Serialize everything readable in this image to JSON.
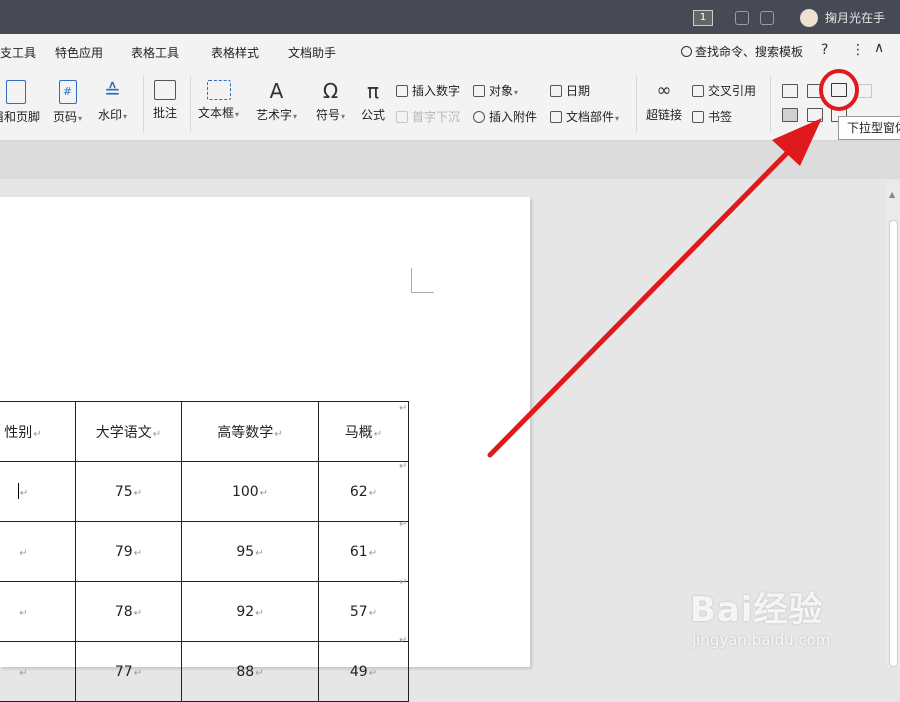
{
  "titlebar": {
    "badge": "1",
    "username": "掬月光在手"
  },
  "menu": {
    "tabs": [
      "支工具",
      "特色应用",
      "表格工具",
      "表格样式",
      "文档助手"
    ],
    "search_label": "查找命令、搜索模板",
    "help": "?",
    "more": "⋮",
    "collapse": "∧"
  },
  "ribbon": {
    "header_footer": "眉和页脚",
    "page_number": "页码",
    "watermark": "水印",
    "comment": "批注",
    "textbox": "文本框",
    "wordart": "艺术字",
    "symbol": "符号",
    "formula": "公式",
    "insert_number": "插入数字",
    "drop_cap": "首字下沉",
    "object": "对象",
    "attachment": "插入附件",
    "date": "日期",
    "doc_parts": "文档部件",
    "hyperlink": "超链接",
    "cross_ref": "交叉引用",
    "bookmark": "书签",
    "tooltip": "下拉型窗体"
  },
  "table": {
    "headers": [
      "性别",
      "大学语文",
      "高等数学",
      "马概"
    ],
    "rows": [
      [
        "",
        "75",
        "100",
        "62"
      ],
      [
        "",
        "79",
        "95",
        "61"
      ],
      [
        "",
        "78",
        "92",
        "57"
      ],
      [
        "",
        "77",
        "88",
        "49"
      ]
    ]
  },
  "watermark": {
    "brand": "Bai经验",
    "url": "jingyan.baidu.com"
  },
  "colors": {
    "annotation": "#e0191c",
    "titlebar": "#474a55",
    "accent": "#2f6ebc"
  }
}
